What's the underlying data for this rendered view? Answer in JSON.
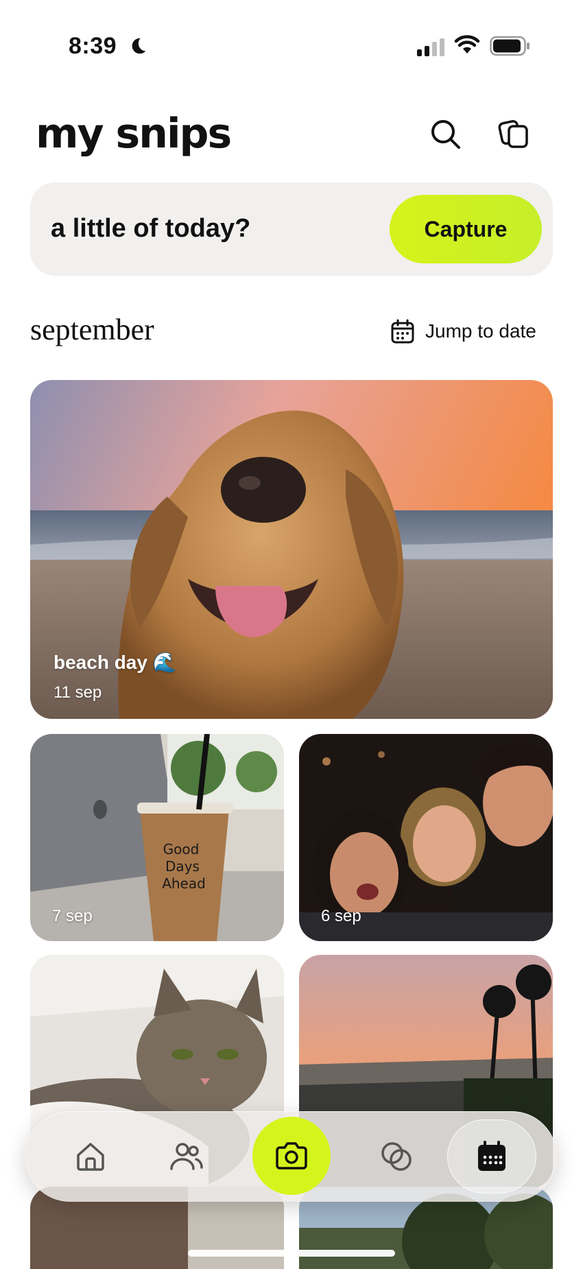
{
  "status_bar": {
    "time": "8:39"
  },
  "header": {
    "title": "my snips"
  },
  "capture_bar": {
    "prompt": "a little of today?",
    "button_label": "Capture"
  },
  "month_section": {
    "month": "september",
    "jump_label": "Jump to date"
  },
  "featured_snip": {
    "title": "beach day 🌊",
    "date": "11 sep"
  },
  "snips": [
    {
      "date": "7 sep"
    },
    {
      "date": "6 sep"
    }
  ],
  "tab_bar": {
    "items": [
      {
        "icon": "home-icon"
      },
      {
        "icon": "friends-icon"
      },
      {
        "icon": "camera-icon"
      },
      {
        "icon": "groups-icon"
      },
      {
        "icon": "calendar-icon"
      }
    ],
    "accent": "#d4f51c"
  }
}
